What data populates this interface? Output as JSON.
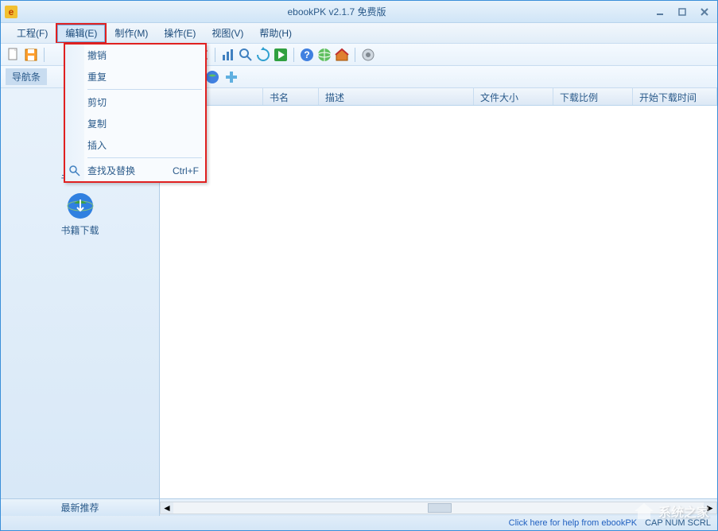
{
  "title": "ebookPK v2.1.7  免费版",
  "menubar": {
    "items": [
      {
        "label": "工程(F)"
      },
      {
        "label": "编辑(E)"
      },
      {
        "label": "制作(M)"
      },
      {
        "label": "操作(E)"
      },
      {
        "label": "视图(V)"
      },
      {
        "label": "帮助(H)"
      }
    ]
  },
  "dropdown": {
    "items": [
      {
        "label": "撤销",
        "shortcut": ""
      },
      {
        "label": "重复",
        "shortcut": ""
      },
      {
        "label": "剪切",
        "shortcut": ""
      },
      {
        "label": "复制",
        "shortcut": ""
      },
      {
        "label": "插入",
        "shortcut": ""
      },
      {
        "label": "查找及替换",
        "shortcut": "Ctrl+F",
        "icon": "search"
      }
    ]
  },
  "toolbar2": {
    "nav_label": "导航条"
  },
  "sidebar": {
    "items": [
      {
        "label": "书籍上传",
        "icon": "upload"
      },
      {
        "label": "书籍下载",
        "icon": "download"
      }
    ]
  },
  "table": {
    "columns": [
      {
        "label": "",
        "width": 130
      },
      {
        "label": "书名",
        "width": 70
      },
      {
        "label": "描述",
        "width": 195
      },
      {
        "label": "文件大小",
        "width": 100
      },
      {
        "label": "下载比例",
        "width": 100
      },
      {
        "label": "开始下载时间",
        "width": 90
      }
    ]
  },
  "bottom": {
    "recommend": "最新推荐"
  },
  "status": {
    "help_link": "Click here for help from ebookPK",
    "indicators": "CAP  NUM  SCRL"
  },
  "watermark": "系统之家"
}
